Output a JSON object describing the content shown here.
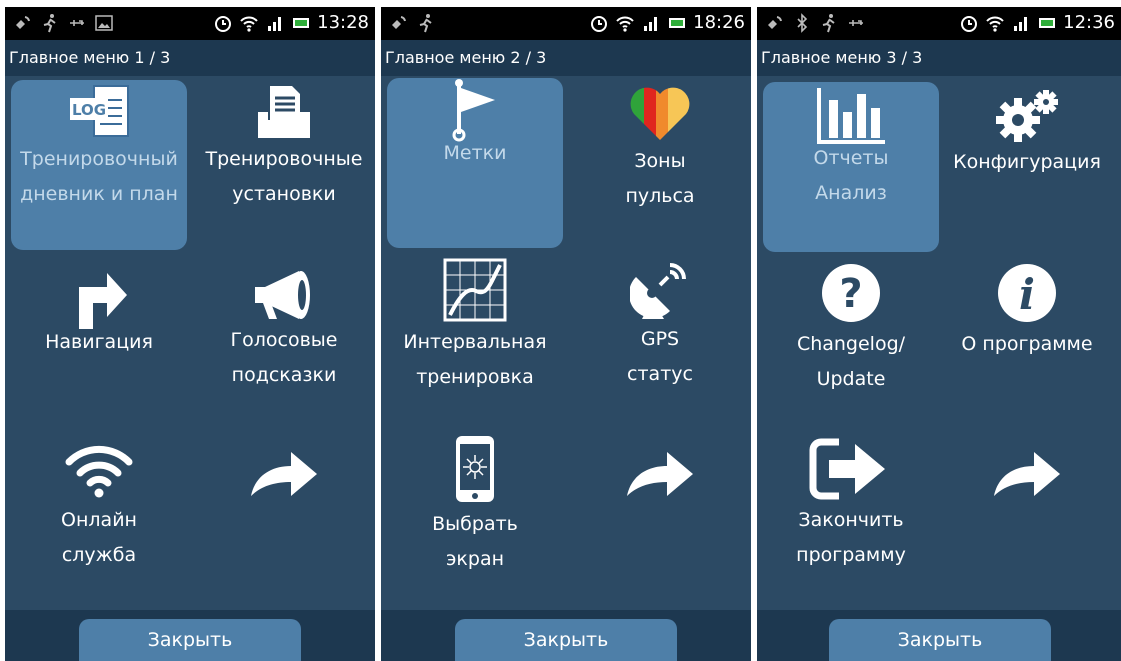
{
  "screens": [
    {
      "time": "13:28",
      "title": "Главное меню 1 / 3",
      "items": [
        {
          "l1": "Тренировочный",
          "l2": "дневник и план",
          "icon": "log-icon"
        },
        {
          "l1": "Тренировочные",
          "l2": "установки",
          "icon": "document-tray-icon"
        },
        {
          "l1": "Навигация",
          "l2": "",
          "icon": "turn-right-arrow-icon"
        },
        {
          "l1": "Голосовые",
          "l2": "подсказки",
          "icon": "megaphone-icon"
        },
        {
          "l1": "Онлайн",
          "l2": "служба",
          "icon": "wifi-icon"
        },
        {
          "l1": "",
          "l2": "",
          "icon": "forward-arrow-icon"
        }
      ],
      "close": "Закрыть"
    },
    {
      "time": "18:26",
      "title": "Главное меню 2 / 3",
      "items": [
        {
          "l1": "Метки",
          "l2": "",
          "icon": "flag-icon"
        },
        {
          "l1": "Зоны",
          "l2": "пульса",
          "icon": "heart-zones-icon"
        },
        {
          "l1": "Интервальная",
          "l2": "тренировка",
          "icon": "interval-chart-icon"
        },
        {
          "l1": "GPS",
          "l2": "статус",
          "icon": "satellite-dish-icon"
        },
        {
          "l1": "Выбрать",
          "l2": "экран",
          "icon": "phone-screen-icon"
        },
        {
          "l1": "",
          "l2": "",
          "icon": "forward-arrow-icon"
        }
      ],
      "close": "Закрыть"
    },
    {
      "time": "12:36",
      "title": "Главное меню 3 / 3",
      "items": [
        {
          "l1": "Отчеты",
          "l2": "Анализ",
          "icon": "bar-chart-icon"
        },
        {
          "l1": "Конфигурация",
          "l2": "",
          "icon": "gears-icon"
        },
        {
          "l1": "Changelog/",
          "l2": "Update",
          "icon": "question-icon"
        },
        {
          "l1": "О программе",
          "l2": "",
          "icon": "info-icon"
        },
        {
          "l1": "Закончить",
          "l2": "программу",
          "icon": "exit-icon"
        },
        {
          "l1": "",
          "l2": "",
          "icon": "forward-arrow-icon"
        }
      ],
      "close": "Закрыть"
    }
  ],
  "colors": {
    "background": "#2c4a64",
    "bar": "#1d3850",
    "selected_tile": "#4e7fa8",
    "button": "#4e7fa8"
  }
}
